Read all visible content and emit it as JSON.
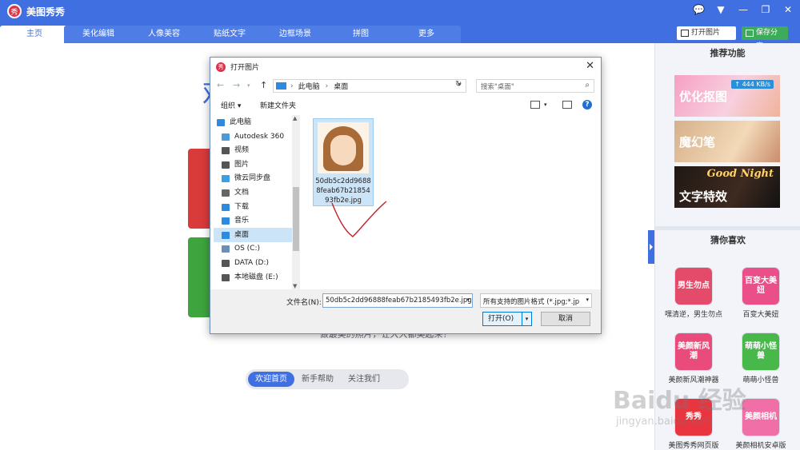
{
  "app": {
    "logo_char": "秀",
    "title": "美图秀秀"
  },
  "window_controls": [
    "💬",
    "▼",
    "—",
    "❐",
    "✕"
  ],
  "tabs": [
    "主页",
    "美化编辑",
    "人像美容",
    "贴纸文字",
    "边框场景",
    "拼图",
    "更多"
  ],
  "top_buttons": {
    "open": "打开图片",
    "save": "保存分享"
  },
  "main": {
    "slogan": "做最美的照片，让人人都美起来！",
    "welcome_nav": [
      "欢迎首页",
      "新手帮助",
      "关注我们"
    ]
  },
  "right_panel": {
    "recommended_title": "推荐功能",
    "promos": [
      {
        "label": "优化抠图",
        "badge": "↑ 444 KB/s"
      },
      {
        "label": "魔幻笔"
      },
      {
        "label": "文字特效",
        "badge": "Good Night"
      }
    ],
    "guess_title": "猜你喜欢",
    "apps": [
      {
        "icon_text": "男生勿点",
        "label": "嘿清逆，男生勿点",
        "color": "#e44b6a"
      },
      {
        "icon_text": "百变大美妞",
        "label": "百变大美妞",
        "color": "#ea4f8a"
      },
      {
        "icon_text": "美颜新风潮",
        "label": "美颜新风潮神器",
        "color": "#e94c7a"
      },
      {
        "icon_text": "萌萌小怪兽",
        "label": "萌萌小怪兽",
        "color": "#49b84b"
      },
      {
        "icon_text": "秀秀",
        "label": "美图秀秀网页版",
        "color": "#e8353f"
      },
      {
        "icon_text": "美颜相机",
        "label": "美颜相机安卓版",
        "color": "#f06fa6"
      }
    ]
  },
  "dialog": {
    "title": "打开图片",
    "breadcrumb": [
      "此电脑",
      "桌面"
    ],
    "search_placeholder": "搜索\"桌面\"",
    "organize": "组织 ▾",
    "new_folder": "新建文件夹",
    "tree": [
      {
        "label": "此电脑",
        "icon": "computer-icon",
        "color": "#2d8ae0"
      },
      {
        "label": "Autodesk 360",
        "icon": "cloud-icon",
        "color": "#4a9bd8"
      },
      {
        "label": "视频",
        "icon": "video-icon",
        "color": "#555"
      },
      {
        "label": "图片",
        "icon": "picture-icon",
        "color": "#555"
      },
      {
        "label": "微云同步盘",
        "icon": "weiyun-icon",
        "color": "#3aa0e6"
      },
      {
        "label": "文档",
        "icon": "document-icon",
        "color": "#666"
      },
      {
        "label": "下载",
        "icon": "download-icon",
        "color": "#2d8ae0"
      },
      {
        "label": "音乐",
        "icon": "music-icon",
        "color": "#2d8ae0"
      },
      {
        "label": "桌面",
        "icon": "desktop-icon",
        "color": "#2d8ae0"
      },
      {
        "label": "OS (C:)",
        "icon": "drive-icon",
        "color": "#6a8fb8"
      },
      {
        "label": "DATA (D:)",
        "icon": "drive-icon",
        "color": "#555"
      },
      {
        "label": "本地磁盘 (E:)",
        "icon": "drive-icon",
        "color": "#555"
      }
    ],
    "selected_tree_index": 8,
    "file": {
      "name": "50db5c2dd96888feab67b2185493fb2e.jpg"
    },
    "filename_label": "文件名(N):",
    "filename_value": "50db5c2dd96888feab67b2185493fb2e.jpg",
    "filter_value": "所有支持的图片格式 (*.jpg;*.jp",
    "open_button": "打开(O)",
    "cancel_button": "取消"
  },
  "watermark": {
    "main": "Baidu 经验",
    "sub": "jingyan.baidu.com"
  }
}
